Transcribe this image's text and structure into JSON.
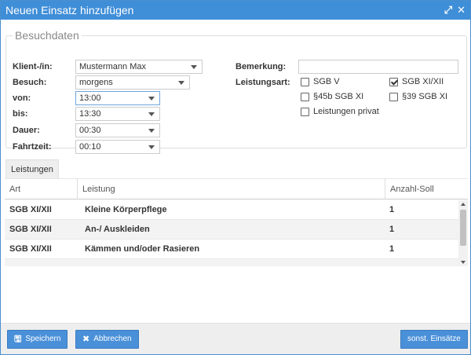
{
  "window": {
    "title": "Neuen Einsatz hinzufügen",
    "icons": [
      "expand-icon",
      "close-icon"
    ]
  },
  "besuchdaten": {
    "legend": "Besuchdaten",
    "klient_label": "Klient-/in:",
    "klient_value": "Mustermann Max",
    "besuch_label": "Besuch:",
    "besuch_value": "morgens",
    "von_label": "von:",
    "von_value": "13:00",
    "bis_label": "bis:",
    "bis_value": "13:30",
    "dauer_label": "Dauer:",
    "dauer_value": "00:30",
    "fahrzeit_label": "Fahrtzeit:",
    "fahrzeit_value": "00:10",
    "bemerkung_label": "Bemerkung:",
    "bemerkung_value": "",
    "leistungsart_label": "Leistungsart:",
    "leistungsarten": [
      {
        "label": "SGB V",
        "checked": false
      },
      {
        "label": "SGB XI/XII",
        "checked": true
      },
      {
        "label": "§45b SGB XI",
        "checked": false
      },
      {
        "label": "§39 SGB XI",
        "checked": false
      },
      {
        "label": "Leistungen privat",
        "checked": false
      }
    ]
  },
  "leistungen": {
    "tab_label": "Leistungen",
    "columns": [
      "Art",
      "Leistung",
      "Anzahl-Soll"
    ],
    "rows": [
      {
        "art": "SGB XI/XII",
        "leistung": "Kleine Körperpflege",
        "anzahl": "1"
      },
      {
        "art": "SGB XI/XII",
        "leistung": "An-/ Auskleiden",
        "anzahl": "1"
      },
      {
        "art": "SGB XI/XII",
        "leistung": "Kämmen und/oder Rasieren",
        "anzahl": "1"
      }
    ]
  },
  "footer": {
    "save_label": "Speichern",
    "cancel_label": "Abbrechen",
    "other_label": "sonst. Einsätze"
  },
  "colors": {
    "titlebar": "#3f8ed8",
    "button": "#4a90d9"
  }
}
